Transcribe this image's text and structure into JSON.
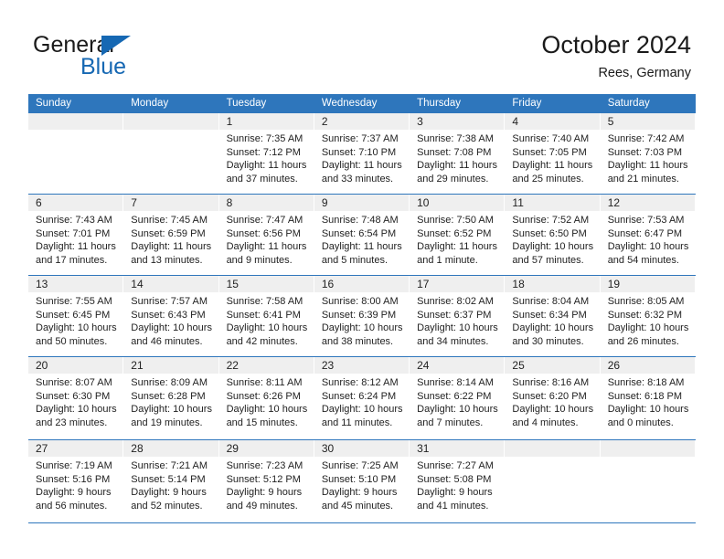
{
  "brand": {
    "name_part1": "General",
    "name_part2": "Blue",
    "logo_icon": "blue-triangle-logo"
  },
  "header": {
    "title": "October 2024",
    "subtitle": "Rees, Germany"
  },
  "colors": {
    "header_blue": "#2e76bc",
    "brand_blue": "#1668b3",
    "date_strip": "#efefef",
    "text": "#222222"
  },
  "weekdays": [
    "Sunday",
    "Monday",
    "Tuesday",
    "Wednesday",
    "Thursday",
    "Friday",
    "Saturday"
  ],
  "weeks": [
    [
      {
        "day": "",
        "sunrise": "",
        "sunset": "",
        "daylight1": "",
        "daylight2": "",
        "empty": true
      },
      {
        "day": "",
        "sunrise": "",
        "sunset": "",
        "daylight1": "",
        "daylight2": "",
        "empty": true
      },
      {
        "day": "1",
        "sunrise": "Sunrise: 7:35 AM",
        "sunset": "Sunset: 7:12 PM",
        "daylight1": "Daylight: 11 hours",
        "daylight2": "and 37 minutes."
      },
      {
        "day": "2",
        "sunrise": "Sunrise: 7:37 AM",
        "sunset": "Sunset: 7:10 PM",
        "daylight1": "Daylight: 11 hours",
        "daylight2": "and 33 minutes."
      },
      {
        "day": "3",
        "sunrise": "Sunrise: 7:38 AM",
        "sunset": "Sunset: 7:08 PM",
        "daylight1": "Daylight: 11 hours",
        "daylight2": "and 29 minutes."
      },
      {
        "day": "4",
        "sunrise": "Sunrise: 7:40 AM",
        "sunset": "Sunset: 7:05 PM",
        "daylight1": "Daylight: 11 hours",
        "daylight2": "and 25 minutes."
      },
      {
        "day": "5",
        "sunrise": "Sunrise: 7:42 AM",
        "sunset": "Sunset: 7:03 PM",
        "daylight1": "Daylight: 11 hours",
        "daylight2": "and 21 minutes."
      }
    ],
    [
      {
        "day": "6",
        "sunrise": "Sunrise: 7:43 AM",
        "sunset": "Sunset: 7:01 PM",
        "daylight1": "Daylight: 11 hours",
        "daylight2": "and 17 minutes."
      },
      {
        "day": "7",
        "sunrise": "Sunrise: 7:45 AM",
        "sunset": "Sunset: 6:59 PM",
        "daylight1": "Daylight: 11 hours",
        "daylight2": "and 13 minutes."
      },
      {
        "day": "8",
        "sunrise": "Sunrise: 7:47 AM",
        "sunset": "Sunset: 6:56 PM",
        "daylight1": "Daylight: 11 hours",
        "daylight2": "and 9 minutes."
      },
      {
        "day": "9",
        "sunrise": "Sunrise: 7:48 AM",
        "sunset": "Sunset: 6:54 PM",
        "daylight1": "Daylight: 11 hours",
        "daylight2": "and 5 minutes."
      },
      {
        "day": "10",
        "sunrise": "Sunrise: 7:50 AM",
        "sunset": "Sunset: 6:52 PM",
        "daylight1": "Daylight: 11 hours",
        "daylight2": "and 1 minute."
      },
      {
        "day": "11",
        "sunrise": "Sunrise: 7:52 AM",
        "sunset": "Sunset: 6:50 PM",
        "daylight1": "Daylight: 10 hours",
        "daylight2": "and 57 minutes."
      },
      {
        "day": "12",
        "sunrise": "Sunrise: 7:53 AM",
        "sunset": "Sunset: 6:47 PM",
        "daylight1": "Daylight: 10 hours",
        "daylight2": "and 54 minutes."
      }
    ],
    [
      {
        "day": "13",
        "sunrise": "Sunrise: 7:55 AM",
        "sunset": "Sunset: 6:45 PM",
        "daylight1": "Daylight: 10 hours",
        "daylight2": "and 50 minutes."
      },
      {
        "day": "14",
        "sunrise": "Sunrise: 7:57 AM",
        "sunset": "Sunset: 6:43 PM",
        "daylight1": "Daylight: 10 hours",
        "daylight2": "and 46 minutes."
      },
      {
        "day": "15",
        "sunrise": "Sunrise: 7:58 AM",
        "sunset": "Sunset: 6:41 PM",
        "daylight1": "Daylight: 10 hours",
        "daylight2": "and 42 minutes."
      },
      {
        "day": "16",
        "sunrise": "Sunrise: 8:00 AM",
        "sunset": "Sunset: 6:39 PM",
        "daylight1": "Daylight: 10 hours",
        "daylight2": "and 38 minutes."
      },
      {
        "day": "17",
        "sunrise": "Sunrise: 8:02 AM",
        "sunset": "Sunset: 6:37 PM",
        "daylight1": "Daylight: 10 hours",
        "daylight2": "and 34 minutes."
      },
      {
        "day": "18",
        "sunrise": "Sunrise: 8:04 AM",
        "sunset": "Sunset: 6:34 PM",
        "daylight1": "Daylight: 10 hours",
        "daylight2": "and 30 minutes."
      },
      {
        "day": "19",
        "sunrise": "Sunrise: 8:05 AM",
        "sunset": "Sunset: 6:32 PM",
        "daylight1": "Daylight: 10 hours",
        "daylight2": "and 26 minutes."
      }
    ],
    [
      {
        "day": "20",
        "sunrise": "Sunrise: 8:07 AM",
        "sunset": "Sunset: 6:30 PM",
        "daylight1": "Daylight: 10 hours",
        "daylight2": "and 23 minutes."
      },
      {
        "day": "21",
        "sunrise": "Sunrise: 8:09 AM",
        "sunset": "Sunset: 6:28 PM",
        "daylight1": "Daylight: 10 hours",
        "daylight2": "and 19 minutes."
      },
      {
        "day": "22",
        "sunrise": "Sunrise: 8:11 AM",
        "sunset": "Sunset: 6:26 PM",
        "daylight1": "Daylight: 10 hours",
        "daylight2": "and 15 minutes."
      },
      {
        "day": "23",
        "sunrise": "Sunrise: 8:12 AM",
        "sunset": "Sunset: 6:24 PM",
        "daylight1": "Daylight: 10 hours",
        "daylight2": "and 11 minutes."
      },
      {
        "day": "24",
        "sunrise": "Sunrise: 8:14 AM",
        "sunset": "Sunset: 6:22 PM",
        "daylight1": "Daylight: 10 hours",
        "daylight2": "and 7 minutes."
      },
      {
        "day": "25",
        "sunrise": "Sunrise: 8:16 AM",
        "sunset": "Sunset: 6:20 PM",
        "daylight1": "Daylight: 10 hours",
        "daylight2": "and 4 minutes."
      },
      {
        "day": "26",
        "sunrise": "Sunrise: 8:18 AM",
        "sunset": "Sunset: 6:18 PM",
        "daylight1": "Daylight: 10 hours",
        "daylight2": "and 0 minutes."
      }
    ],
    [
      {
        "day": "27",
        "sunrise": "Sunrise: 7:19 AM",
        "sunset": "Sunset: 5:16 PM",
        "daylight1": "Daylight: 9 hours",
        "daylight2": "and 56 minutes."
      },
      {
        "day": "28",
        "sunrise": "Sunrise: 7:21 AM",
        "sunset": "Sunset: 5:14 PM",
        "daylight1": "Daylight: 9 hours",
        "daylight2": "and 52 minutes."
      },
      {
        "day": "29",
        "sunrise": "Sunrise: 7:23 AM",
        "sunset": "Sunset: 5:12 PM",
        "daylight1": "Daylight: 9 hours",
        "daylight2": "and 49 minutes."
      },
      {
        "day": "30",
        "sunrise": "Sunrise: 7:25 AM",
        "sunset": "Sunset: 5:10 PM",
        "daylight1": "Daylight: 9 hours",
        "daylight2": "and 45 minutes."
      },
      {
        "day": "31",
        "sunrise": "Sunrise: 7:27 AM",
        "sunset": "Sunset: 5:08 PM",
        "daylight1": "Daylight: 9 hours",
        "daylight2": "and 41 minutes."
      },
      {
        "day": "",
        "sunrise": "",
        "sunset": "",
        "daylight1": "",
        "daylight2": "",
        "empty": true
      },
      {
        "day": "",
        "sunrise": "",
        "sunset": "",
        "daylight1": "",
        "daylight2": "",
        "empty": true
      }
    ]
  ]
}
